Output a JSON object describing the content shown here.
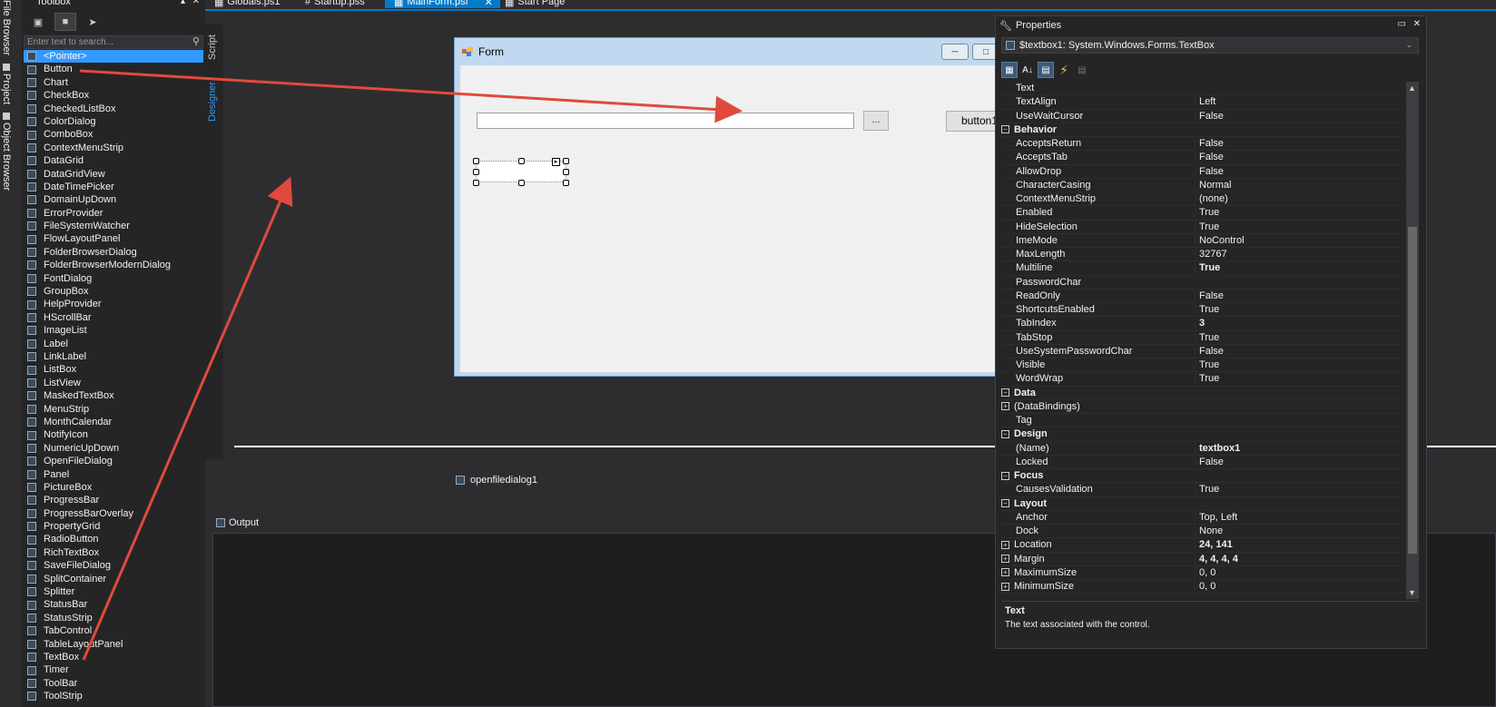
{
  "side_strip": {
    "file_browser": "File Browser",
    "project": "Project",
    "object_browser": "Object Browser"
  },
  "toolbox": {
    "title": "Toolbox",
    "search_placeholder": "Enter text to search...",
    "items": [
      "<Pointer>",
      "Button",
      "Chart",
      "CheckBox",
      "CheckedListBox",
      "ColorDialog",
      "ComboBox",
      "ContextMenuStrip",
      "DataGrid",
      "DataGridView",
      "DateTimePicker",
      "DomainUpDown",
      "ErrorProvider",
      "FileSystemWatcher",
      "FlowLayoutPanel",
      "FolderBrowserDialog",
      "FolderBrowserModernDialog",
      "FontDialog",
      "GroupBox",
      "HelpProvider",
      "HScrollBar",
      "ImageList",
      "Label",
      "LinkLabel",
      "ListBox",
      "ListView",
      "MaskedTextBox",
      "MenuStrip",
      "MonthCalendar",
      "NotifyIcon",
      "NumericUpDown",
      "OpenFileDialog",
      "Panel",
      "PictureBox",
      "ProgressBar",
      "ProgressBarOverlay",
      "PropertyGrid",
      "RadioButton",
      "RichTextBox",
      "SaveFileDialog",
      "SplitContainer",
      "Splitter",
      "StatusBar",
      "StatusStrip",
      "TabControl",
      "TableLayoutPanel",
      "TextBox",
      "Timer",
      "ToolBar",
      "ToolStrip"
    ]
  },
  "doc_tabs": [
    "Globals.ps1",
    "Startup.pss",
    "MainForm.psf",
    "Start Page"
  ],
  "designer": {
    "side_tabs": [
      "Script",
      "Designer"
    ],
    "form_title": "Form",
    "browse_label": "...",
    "button_label": "button1",
    "tray_item": "openfiledialog1"
  },
  "output": {
    "title": "Output"
  },
  "properties": {
    "title": "Properties",
    "object": "$textbox1: System.Windows.Forms.TextBox",
    "rows": [
      {
        "type": "prop",
        "name": "Text",
        "value": ""
      },
      {
        "type": "prop",
        "name": "TextAlign",
        "value": "Left"
      },
      {
        "type": "prop",
        "name": "UseWaitCursor",
        "value": "False"
      },
      {
        "type": "cat",
        "name": "Behavior"
      },
      {
        "type": "prop",
        "name": "AcceptsReturn",
        "value": "False"
      },
      {
        "type": "prop",
        "name": "AcceptsTab",
        "value": "False"
      },
      {
        "type": "prop",
        "name": "AllowDrop",
        "value": "False"
      },
      {
        "type": "prop",
        "name": "CharacterCasing",
        "value": "Normal"
      },
      {
        "type": "prop",
        "name": "ContextMenuStrip",
        "value": "(none)"
      },
      {
        "type": "prop",
        "name": "Enabled",
        "value": "True"
      },
      {
        "type": "prop",
        "name": "HideSelection",
        "value": "True"
      },
      {
        "type": "prop",
        "name": "ImeMode",
        "value": "NoControl"
      },
      {
        "type": "prop",
        "name": "MaxLength",
        "value": "32767"
      },
      {
        "type": "prop",
        "name": "Multiline",
        "value": "True",
        "bold": true
      },
      {
        "type": "prop",
        "name": "PasswordChar",
        "value": ""
      },
      {
        "type": "prop",
        "name": "ReadOnly",
        "value": "False"
      },
      {
        "type": "prop",
        "name": "ShortcutsEnabled",
        "value": "True"
      },
      {
        "type": "prop",
        "name": "TabIndex",
        "value": "3",
        "bold": true
      },
      {
        "type": "prop",
        "name": "TabStop",
        "value": "True"
      },
      {
        "type": "prop",
        "name": "UseSystemPasswordChar",
        "value": "False"
      },
      {
        "type": "prop",
        "name": "Visible",
        "value": "True"
      },
      {
        "type": "prop",
        "name": "WordWrap",
        "value": "True"
      },
      {
        "type": "cat",
        "name": "Data"
      },
      {
        "type": "exp",
        "name": "(DataBindings)",
        "value": ""
      },
      {
        "type": "prop",
        "name": "Tag",
        "value": ""
      },
      {
        "type": "cat",
        "name": "Design"
      },
      {
        "type": "prop",
        "name": "(Name)",
        "value": "textbox1",
        "bold": true
      },
      {
        "type": "prop",
        "name": "Locked",
        "value": "False"
      },
      {
        "type": "cat",
        "name": "Focus"
      },
      {
        "type": "prop",
        "name": "CausesValidation",
        "value": "True"
      },
      {
        "type": "cat",
        "name": "Layout"
      },
      {
        "type": "prop",
        "name": "Anchor",
        "value": "Top, Left"
      },
      {
        "type": "prop",
        "name": "Dock",
        "value": "None"
      },
      {
        "type": "exp",
        "name": "Location",
        "value": "24, 141",
        "bold": true
      },
      {
        "type": "exp",
        "name": "Margin",
        "value": "4, 4, 4, 4",
        "bold": true
      },
      {
        "type": "exp",
        "name": "MaximumSize",
        "value": "0, 0"
      },
      {
        "type": "exp",
        "name": "MinimumSize",
        "value": "0, 0"
      }
    ],
    "desc_title": "Text",
    "desc_text": "The text associated with the control."
  },
  "colors": {
    "accent": "#007acc",
    "selection": "#3399ff",
    "arrow": "#e04a3c",
    "close_button": "#c8453a"
  }
}
